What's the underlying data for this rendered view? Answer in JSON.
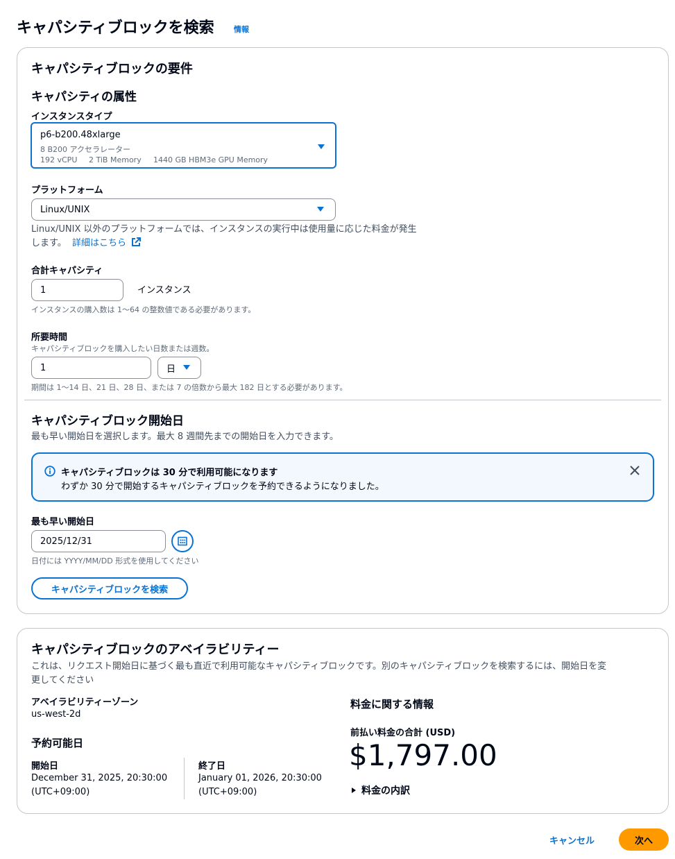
{
  "page": {
    "title": "キャパシティブロックを検索",
    "info_link": "情報"
  },
  "requirements": {
    "title": "キャパシティブロックの要件",
    "attributes_title": "キャパシティの属性",
    "instance_type": {
      "label": "インスタンスタイプ",
      "value": "p6-b200.48xlarge",
      "sub1": "8 B200 アクセラレーター",
      "vcpu": "192 vCPU",
      "memory": "2 TiB Memory",
      "gpu_memory": "1440 GB HBM3e GPU Memory"
    },
    "platform": {
      "label": "プラットフォーム",
      "value": "Linux/UNIX",
      "note": "Linux/UNIX 以外のプラットフォームでは、インスタンスの実行中は使用量に応じた料金が発生",
      "note2": "します。",
      "link": "詳細はこちら"
    },
    "capacity": {
      "label": "合計キャパシティ",
      "value": "1",
      "unit": "インスタンス",
      "hint": "インスタンスの購入数は 1〜64 の整数値である必要があります。"
    },
    "duration": {
      "label": "所要時間",
      "desc": "キャパシティブロックを購入したい日数または週数。",
      "value": "1",
      "unit": "日",
      "hint": "期間は 1〜14 日、21 日、28 日、または 7 の倍数から最大 182 日とする必要があります。"
    }
  },
  "start": {
    "title": "キャパシティブロック開始日",
    "desc": "最も早い開始日を選択します。最大 8 週間先までの開始日を入力できます。",
    "alert_title": "キャパシティブロックは 30 分で利用可能になります",
    "alert_body": "わずか 30 分で開始するキャパシティブロックを予約できるようになりました。",
    "earliest_label": "最も早い開始日",
    "date_value": "2025/12/31",
    "date_hint": "日付には YYYY/MM/DD 形式を使用してください",
    "search_button": "キャパシティブロックを検索"
  },
  "availability": {
    "title": "キャパシティブロックのアベイラビリティー",
    "desc1": "これは、リクエスト開始日に基づく最も直近で利用可能なキャパシティブロックです。別のキャパシティブロックを検索するには、開始日を変",
    "desc2": "更してください",
    "az_label": "アベイラビリティーゾーン",
    "az_value": "us-west-2d",
    "bookable_title": "予約可能日",
    "start_label": "開始日",
    "start_value": "December 31, 2025, 20:30:00",
    "start_tz": "(UTC+09:00)",
    "end_label": "終了日",
    "end_value": "January 01, 2026, 20:30:00",
    "end_tz": "(UTC+09:00)",
    "pricing_title": "料金に関する情報",
    "upfront_label": "前払い料金の合計 (USD)",
    "upfront_value": "$1,797.00",
    "breakdown": "料金の内訳"
  },
  "footer": {
    "cancel": "キャンセル",
    "next": "次へ"
  },
  "colors": {
    "accent": "#0972d3",
    "primary_button": "#ff9900",
    "alert_bg": "#f2f8fd"
  }
}
